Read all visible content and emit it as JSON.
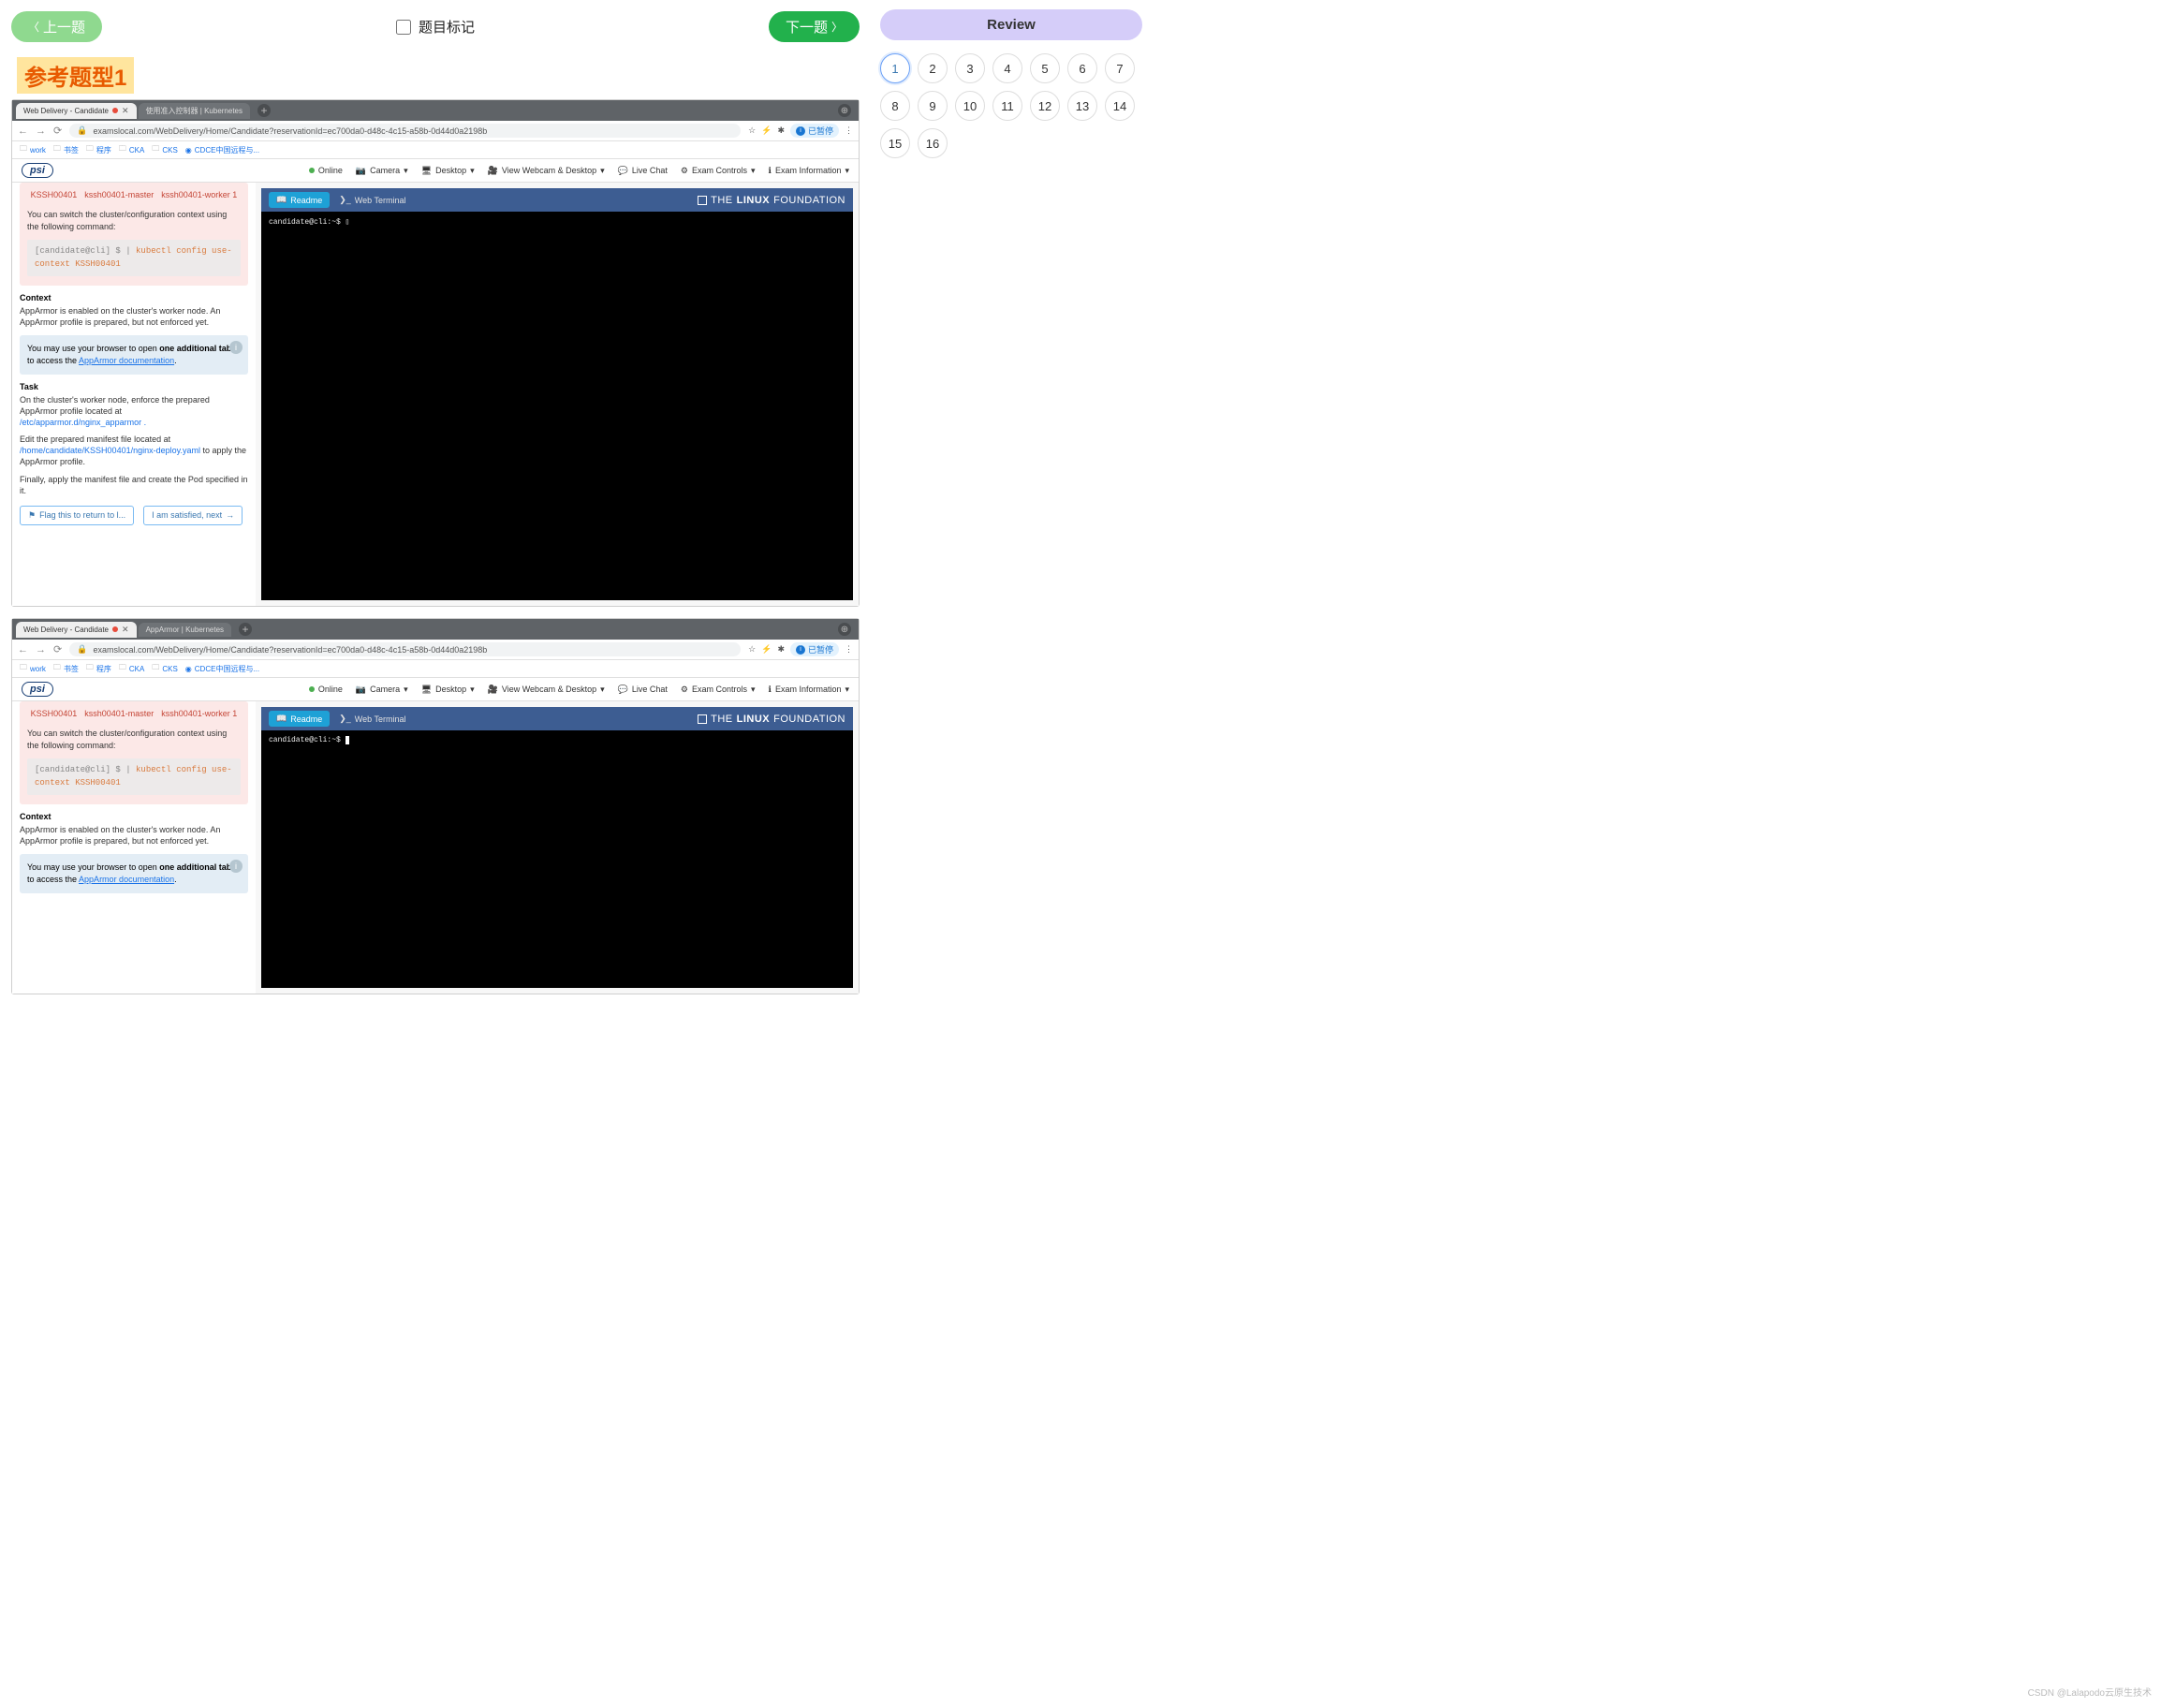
{
  "nav": {
    "prev": "上一题",
    "next": "下一题",
    "mark": "题目标记"
  },
  "title_badge": "参考题型1",
  "browser": {
    "tab_active": "Web Delivery - Candidate",
    "tab_inactive_a": "使用准入控制器 | Kubernetes",
    "tab_inactive_b": "AppArmor | Kubernetes",
    "url": "examslocal.com/WebDelivery/Home/Candidate?reservationId=ec700da0-d48c-4c15-a58b-0d44d0a2198b",
    "paused": "已暂停"
  },
  "bookmarks": {
    "work": "work",
    "bookmarks": "书签",
    "prog": "程序",
    "cka": "CKA",
    "cks": "CKS",
    "cdce": "CDCE中国远程与..."
  },
  "psi": {
    "logo": "psi",
    "online": "Online",
    "camera": "Camera",
    "desktop": "Desktop",
    "webcam": "View Webcam & Desktop",
    "chat": "Live Chat",
    "controls": "Exam Controls",
    "info": "Exam Information"
  },
  "clusters": {
    "c1": "KSSH00401",
    "c2": "kssh00401-master",
    "c3": "kssh00401-worker 1"
  },
  "pink_text": "You can switch the cluster/configuration context using the following command:",
  "code": {
    "prompt": "[candidate@cli] $ |",
    "cmd": "kubectl config use-context KSSH00401"
  },
  "context_h": "Context",
  "context_body": "AppArmor is enabled on the cluster's worker node. An AppArmor profile is prepared, but not enforced yet.",
  "bluecard": {
    "pre": "You may use your browser to open ",
    "bold": "one additional tab",
    "mid": " to access the ",
    "link": "AppArmor documentation",
    "post": "."
  },
  "task_h": "Task",
  "task_p1": "On the cluster's worker node, enforce the prepared AppArmor profile located at",
  "task_path1": " /etc/apparmor.d/nginx_apparmor .",
  "task_p2a": "Edit the prepared manifest file located at",
  "task_path2": " /home/candidate/KSSH00401/nginx-deploy.yaml ",
  "task_p2b": " to apply the AppArmor profile.",
  "task_p3": "Finally, apply the manifest file and create the Pod specified in it.",
  "actions": {
    "flag": "Flag this to return to l...",
    "next": "I am satisfied, next"
  },
  "terminal": {
    "readme": "Readme",
    "webterm": "Web Terminal",
    "lf_thin": "THE",
    "lf_bold": "LINUX",
    "lf_rest": "FOUNDATION",
    "prompt": "candidate@cli:~$"
  },
  "review": {
    "title": "Review",
    "count": 16
  },
  "watermark": "CSDN @Lalapodo云原生技术"
}
